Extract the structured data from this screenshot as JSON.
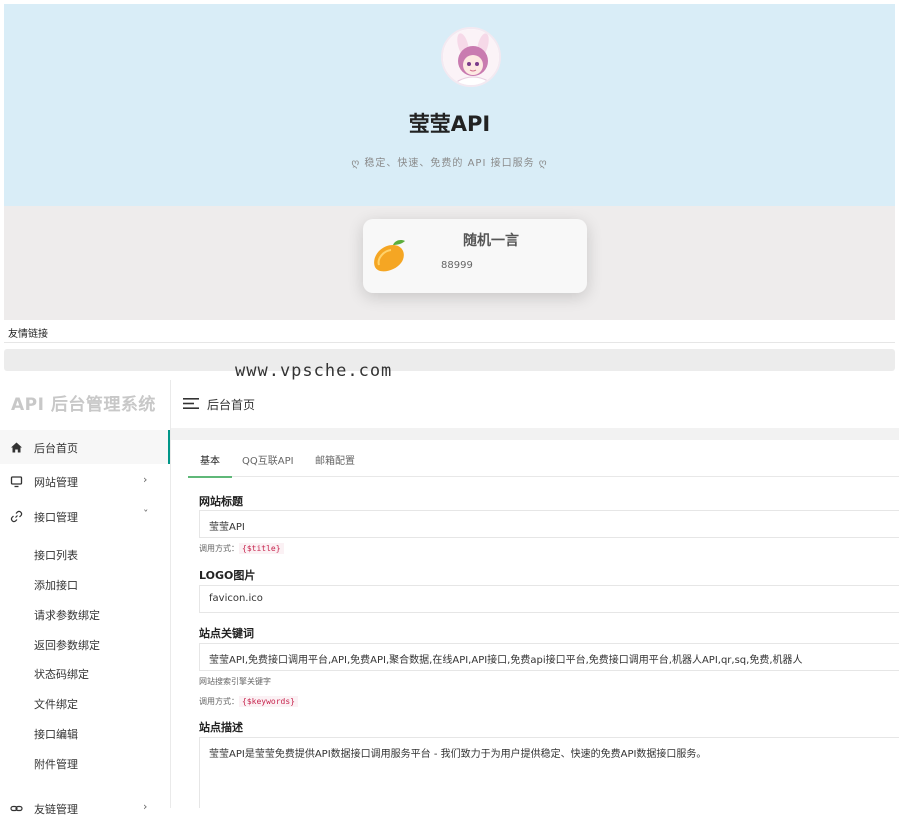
{
  "site": {
    "title": "莹莹API",
    "slogan": "ღ 稳定、快速、免费的 API 接口服务 ღ",
    "quote_title": "随机一言",
    "quote_text": "88999",
    "friend_links_label": "友情链接",
    "watermark": "www.vpsche.com"
  },
  "admin": {
    "logo": "API 后台管理系统",
    "topbar_title": "后台首页",
    "sidebar": {
      "items": [
        {
          "label": "后台首页",
          "icon": "home-icon"
        },
        {
          "label": "网站管理",
          "icon": "monitor-icon",
          "arrow": "›"
        },
        {
          "label": "接口管理",
          "icon": "link-icon",
          "arrow": "ˇ"
        },
        {
          "label": "友链管理",
          "icon": "chain-icon",
          "arrow": "›"
        }
      ],
      "sub_items": [
        "接口列表",
        "添加接口",
        "请求参数绑定",
        "返回参数绑定",
        "状态码绑定",
        "文件绑定",
        "接口编辑",
        "附件管理"
      ]
    },
    "tabs": [
      "基本",
      "QQ互联API",
      "邮箱配置"
    ],
    "form": {
      "title_label": "网站标题",
      "title_value": "莹莹API",
      "title_help": "调用方式：",
      "title_code": "{$title}",
      "logo_label": "LOGO图片",
      "logo_value": "favicon.ico",
      "keywords_label": "站点关键词",
      "keywords_value": "莹莹API,免费接口调用平台,API,免费API,聚合数据,在线API,API接口,免费api接口平台,免费接口调用平台,机器人API,qr,sq,免费,机器人",
      "keywords_hint": "网站搜索引擎关键字",
      "keywords_help": "调用方式：",
      "keywords_code": "{$keywords}",
      "desc_label": "站点描述",
      "desc_value": "莹莹API是莹莹免费提供API数据接口调用服务平台 - 我们致力于为用户提供稳定、快速的免费API数据接口服务。"
    }
  }
}
